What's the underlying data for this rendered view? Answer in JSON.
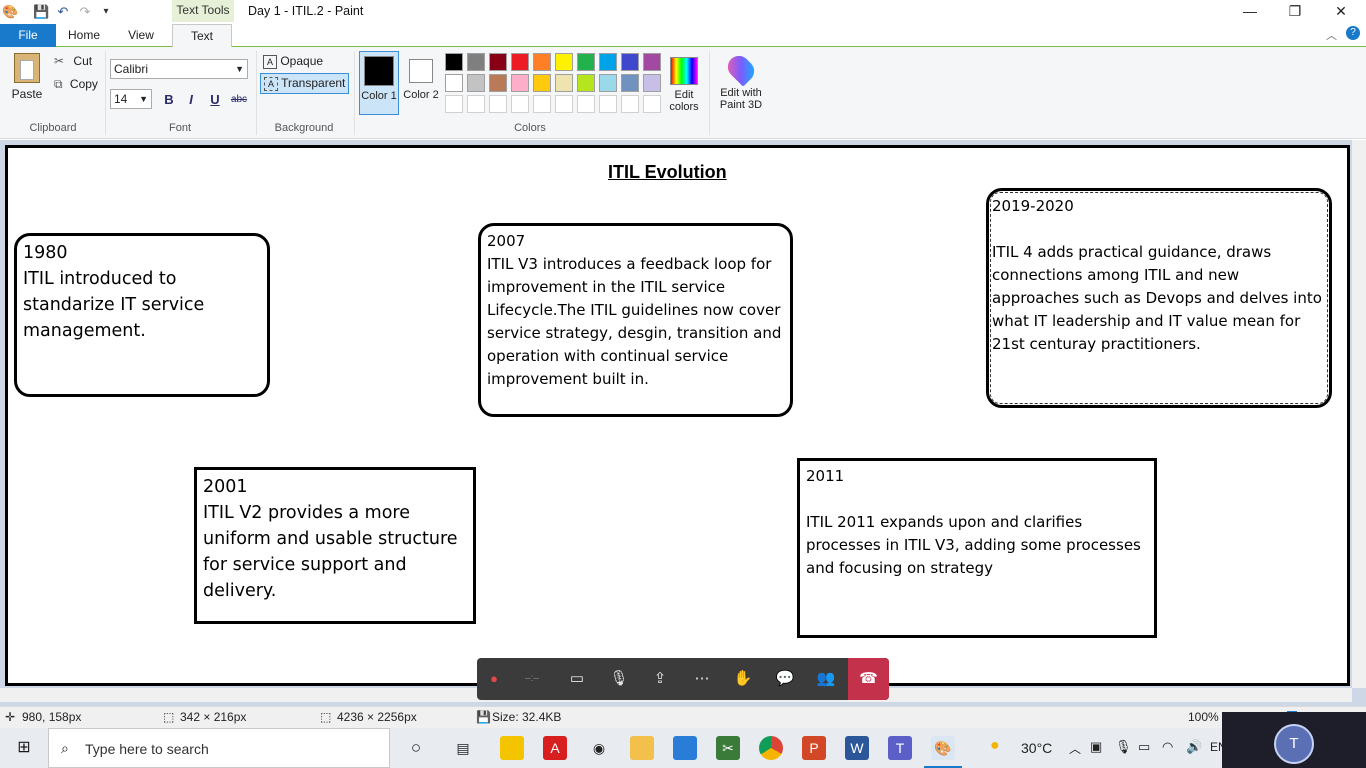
{
  "window": {
    "title": "Day 1 - ITIL.2 - Paint",
    "context_tab": "Text Tools",
    "minimize": "—",
    "restore": "❐",
    "close": "✕"
  },
  "tabs": {
    "file": "File",
    "home": "Home",
    "view": "View",
    "text": "Text"
  },
  "ribbon": {
    "clipboard": {
      "paste": "Paste",
      "cut": "Cut",
      "copy": "Copy",
      "label": "Clipboard"
    },
    "font": {
      "family": "Calibri",
      "size": "14",
      "bold": "B",
      "italic": "I",
      "underline": "U",
      "strike": "abc",
      "label": "Font"
    },
    "background": {
      "opaque": "Opaque",
      "transparent": "Transparent",
      "label": "Background"
    },
    "colors": {
      "color1": "Color 1",
      "color2": "Color 2",
      "edit_colors": "Edit colors",
      "label": "Colors",
      "color1_value": "#000000",
      "color2_value": "#ffffff",
      "palette_row1": [
        "#000000",
        "#7f7f7f",
        "#880015",
        "#ed1c24",
        "#ff7f27",
        "#fff200",
        "#22b14c",
        "#00a2e8",
        "#3f48cc",
        "#a349a4"
      ],
      "palette_row2": [
        "#ffffff",
        "#c3c3c3",
        "#b97a57",
        "#ffaec9",
        "#ffc90e",
        "#efe4b0",
        "#b5e61d",
        "#99d9ea",
        "#7092be",
        "#c8bfe7"
      ]
    },
    "paint3d": "Edit with Paint 3D"
  },
  "document": {
    "title": "ITIL Evolution",
    "cards": [
      {
        "year": "1980",
        "body": "ITIL introduced to standarize IT service management."
      },
      {
        "year": "2007",
        "body": "ITIL V3 introduces a feedback loop for improvement in the ITIL service Lifecycle.The ITIL guidelines now cover service strategy, desgin, transition and operation with continual service improvement built in."
      },
      {
        "year": "2019-2020",
        "body": "ITIL 4 adds practical guidance, draws connections among ITIL and new approaches such as Devops and delves into what IT leadership and IT value mean for 21st centuray practitioners."
      },
      {
        "year": "2001",
        "body": "ITIL V2 provides a more uniform and usable structure for service support and delivery."
      },
      {
        "year": "2011",
        "body": "ITIL 2011 expands upon and clarifies processes in ITIL V3, adding some processes and focusing on strategy"
      }
    ]
  },
  "status": {
    "cursor": "980, 158px",
    "selection": "342 × 216px",
    "image_size": "4236 × 2256px",
    "file_size": "Size: 32.4KB",
    "zoom": "100%"
  },
  "taskbar": {
    "search_placeholder": "Type here to search",
    "weather": "30°C",
    "lang": "EN",
    "avatar": "T"
  }
}
